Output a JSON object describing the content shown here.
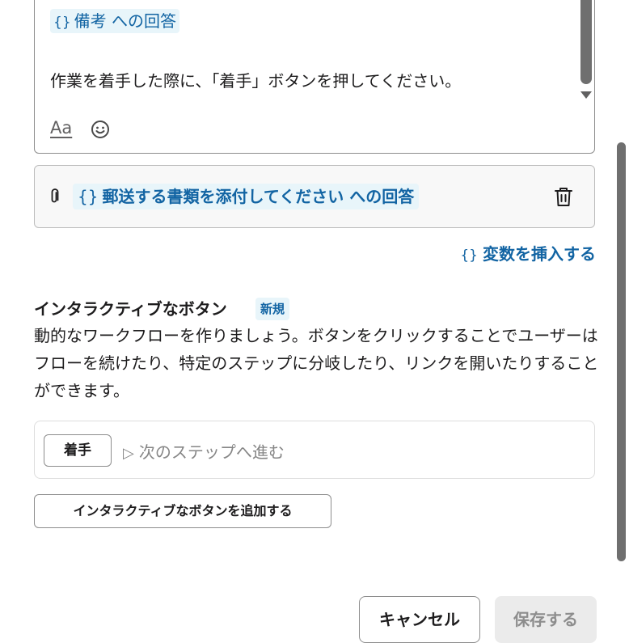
{
  "message_editor": {
    "variable_brace": "{}",
    "variable_label": "備考 への回答",
    "body_text": "作業を着手した際に、「着手」ボタンを押してください。",
    "format_label": "Aa"
  },
  "attachment": {
    "variable_brace": "{}",
    "label": "郵送する書類を添付してください への回答"
  },
  "insert_variable": {
    "brace": "{}",
    "label": "変数を挿入する"
  },
  "interactive_section": {
    "title": "インタラクティブなボタン",
    "badge": "新規",
    "description": "動的なワークフローを作りましょう。ボタンをクリックすることでユーザーはフローを続けたり、特定のステップに分岐したり、リンクを開いたりすることができます。",
    "button_label": "着手",
    "action_icon": "▷",
    "action_text": "次のステップへ進む",
    "add_button": "インタラクティブなボタンを追加する"
  },
  "footer": {
    "cancel": "キャンセル",
    "save": "保存する"
  },
  "colors": {
    "link_blue": "#1264a3",
    "chip_bg": "#e8f5fa"
  }
}
